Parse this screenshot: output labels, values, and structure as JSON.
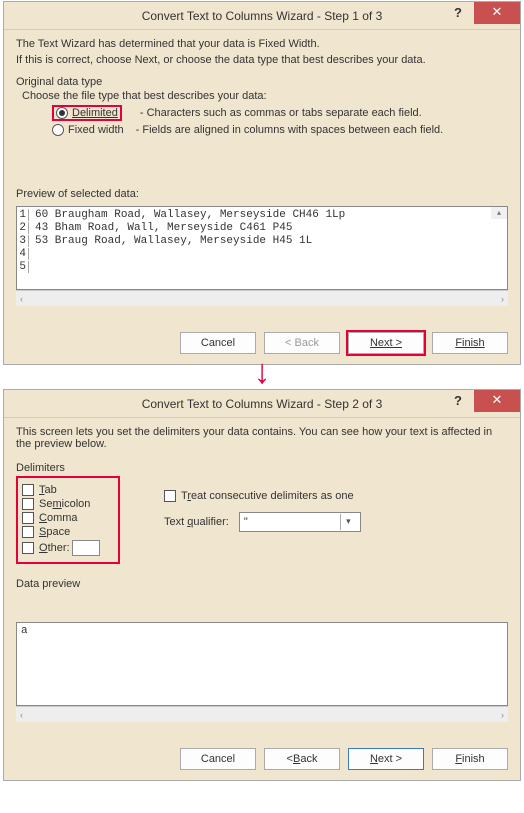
{
  "step1": {
    "title": "Convert Text to Columns Wizard - Step 1 of 3",
    "help": "?",
    "close": "✕",
    "desc1": "The Text Wizard has determined that your data is Fixed Width.",
    "desc2": "If this is correct, choose Next, or choose the data type that best describes your data.",
    "group_label": "Original data type",
    "sub_label": "Choose the file type that best describes your data:",
    "radio_delimited": "Delimited",
    "radio_delimited_desc": "- Characters such as commas or tabs separate each field.",
    "radio_fixed": "Fixed width",
    "radio_fixed_desc": "- Fields are aligned in columns with spaces between each field.",
    "preview_label": "Preview of selected data:",
    "preview_rows": {
      "1": "60 Braugham Road, Wallasey, Merseyside CH46 1Lp",
      "2": "43 Bham Road, Wall, Merseyside C461 P45",
      "3": "53 Braug Road, Wallasey, Merseyside H45 1L",
      "4": "",
      "5": ""
    },
    "buttons": {
      "cancel": "Cancel",
      "back": "< Back",
      "next": "Next >",
      "finish": "Finish"
    }
  },
  "step2": {
    "title": "Convert Text to Columns Wizard - Step 2 of 3",
    "help": "?",
    "close": "✕",
    "desc": "This screen lets you set the delimiters your data contains.  You can see how your text is affected in the preview below.",
    "group_label": "Delimiters",
    "delims": {
      "tab": "Tab",
      "semicolon": "Semicolon",
      "comma": "Comma",
      "space": "Space",
      "other": "Other:"
    },
    "treat_consecutive": "Treat consecutive delimiters as one",
    "text_qualifier_label": "Text qualifier:",
    "text_qualifier_value": "\"",
    "preview_label": "Data preview",
    "preview_text": "a",
    "buttons": {
      "cancel": "Cancel",
      "back": "< Back",
      "next": "Next >",
      "finish": "Finish"
    }
  }
}
